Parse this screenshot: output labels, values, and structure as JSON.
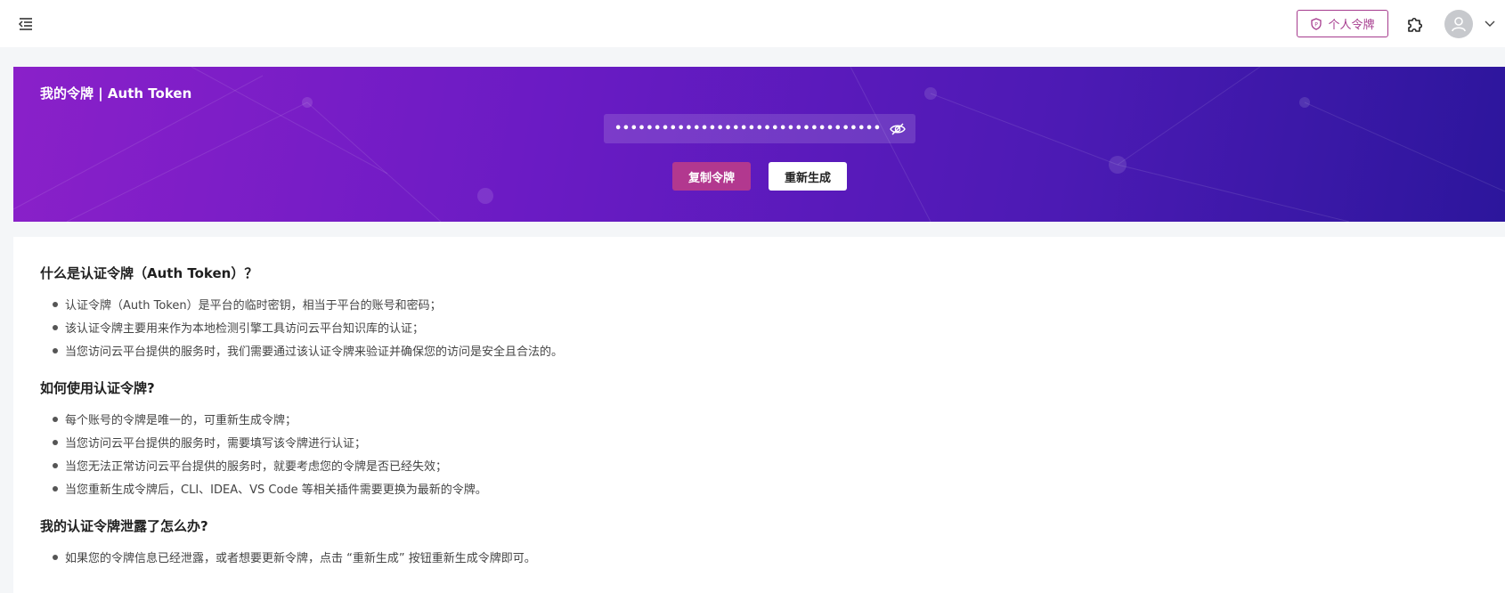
{
  "header": {
    "token_button_label": "个人令牌"
  },
  "hero": {
    "title": "我的令牌 | Auth Token",
    "token_masked": "••••••••••••••••••••••••••••••••••••",
    "copy_label": "复制令牌",
    "regenerate_label": "重新生成"
  },
  "faq": [
    {
      "title": "什么是认证令牌（Auth Token）？",
      "items": [
        "认证令牌（Auth Token）是平台的临时密钥，相当于平台的账号和密码；",
        "该认证令牌主要用来作为本地检测引擎工具访问云平台知识库的认证；",
        "当您访问云平台提供的服务时，我们需要通过该认证令牌来验证并确保您的访问是安全且合法的。"
      ]
    },
    {
      "title": "如何使用认证令牌?",
      "items": [
        "每个账号的令牌是唯一的，可重新生成令牌；",
        "当您访问云平台提供的服务时，需要填写该令牌进行认证；",
        "当您无法正常访问云平台提供的服务时，就要考虑您的令牌是否已经失效；",
        "当您重新生成令牌后，CLI、IDEA、VS Code 等相关插件需要更换为最新的令牌。"
      ]
    },
    {
      "title": "我的认证令牌泄露了怎么办?",
      "items": [
        "如果您的令牌信息已经泄露，或者想要更新令牌，点击 “重新生成” 按钮重新生成令牌即可。"
      ]
    }
  ],
  "colors": {
    "accent": "#b2388f",
    "hero_start": "#8a20c9",
    "hero_end": "#2c169c"
  },
  "icons": {
    "menu": "menu-fold-icon",
    "token": "shield-icon",
    "plugin": "puzzle-icon",
    "avatar": "user-icon",
    "caret": "chevron-down-icon",
    "visibility": "eye-off-icon"
  }
}
